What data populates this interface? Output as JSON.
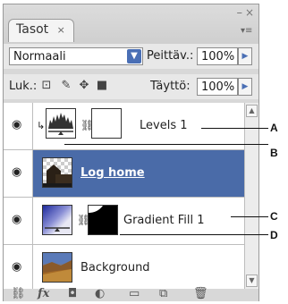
{
  "panel": {
    "tab_label": "Tasot",
    "tab_close": "×",
    "minimize": "–",
    "close": "×",
    "menu_icon": "≡"
  },
  "blend": {
    "mode": "Normaali",
    "opacity_label": "Peittäv.:",
    "opacity_value": "100%"
  },
  "locks": {
    "label": "Luk.:",
    "fill_label": "Täyttö:",
    "fill_value": "100%"
  },
  "layers": [
    {
      "name": "Levels 1",
      "visible": true,
      "selected": false,
      "type": "adjustment"
    },
    {
      "name": "Log home",
      "visible": true,
      "selected": true,
      "type": "image"
    },
    {
      "name": "Gradient Fill 1",
      "visible": true,
      "selected": false,
      "type": "fill"
    },
    {
      "name": "Background",
      "visible": true,
      "selected": false,
      "type": "background"
    }
  ],
  "callouts": [
    "A",
    "B",
    "C",
    "D"
  ],
  "bottom_icons": [
    "link-layers-icon",
    "fx-icon",
    "mask-icon",
    "adjustment-icon",
    "group-icon",
    "new-layer-icon",
    "trash-icon"
  ],
  "colors": {
    "selected_row": "#4a6ba8",
    "accent": "#4a6fb5"
  }
}
